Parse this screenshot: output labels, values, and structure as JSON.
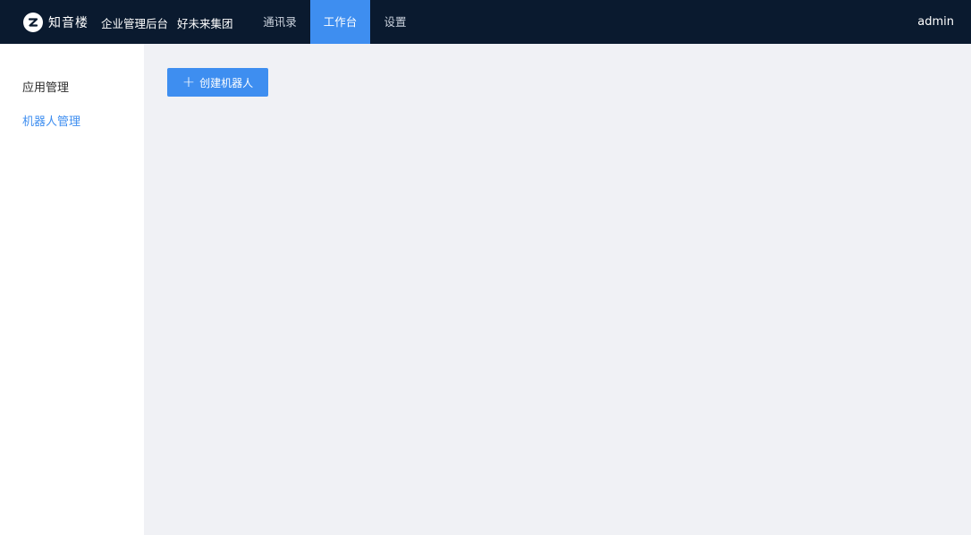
{
  "header": {
    "brand_name": "知音楼",
    "logo_icon": "zhiyinlou-logo-icon",
    "org_title": "企业管理后台",
    "org_name": "好未来集团",
    "tabs": [
      {
        "label": "通讯录",
        "active": false
      },
      {
        "label": "工作台",
        "active": true
      },
      {
        "label": "设置",
        "active": false
      }
    ],
    "user": "admin"
  },
  "sidebar": {
    "items": [
      {
        "label": "应用管理",
        "active": false
      },
      {
        "label": "机器人管理",
        "active": true
      }
    ]
  },
  "main": {
    "create_button_label": "创建机器人",
    "create_button_icon": "plus-icon"
  },
  "colors": {
    "topbar_bg": "#0a1a2f",
    "accent": "#3e8ef0",
    "content_bg": "#f0f1f5",
    "sidebar_bg": "#ffffff"
  }
}
